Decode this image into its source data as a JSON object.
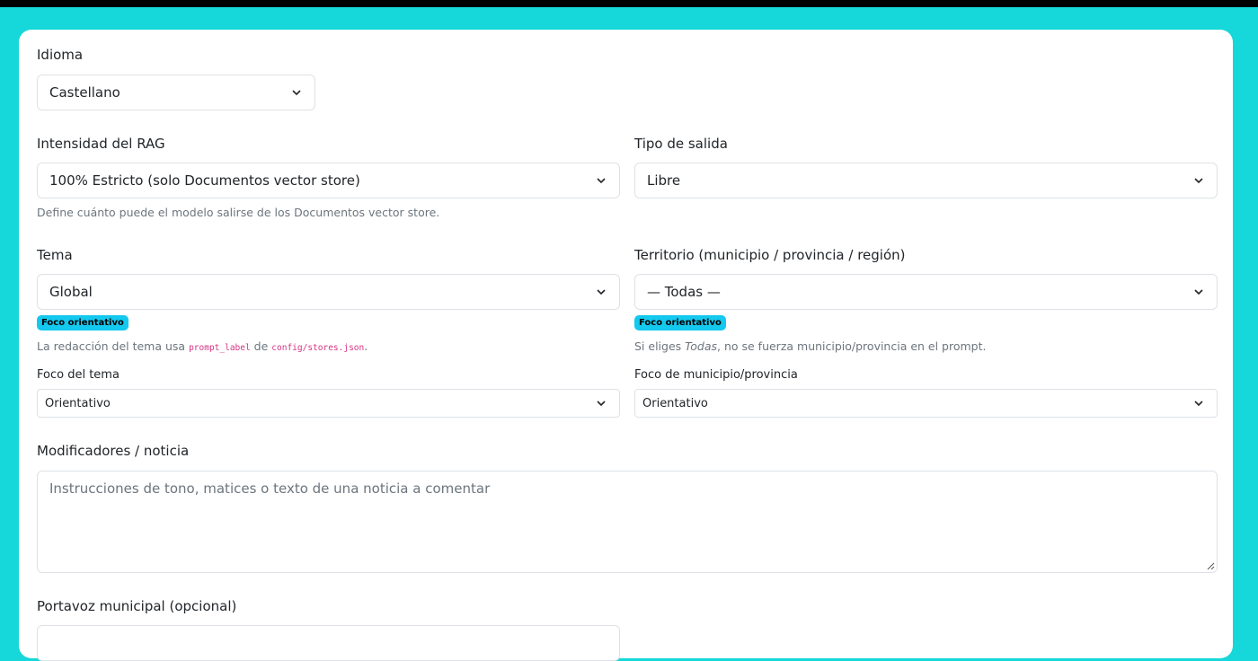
{
  "form": {
    "idioma": {
      "label": "Idioma",
      "value": "Castellano"
    },
    "rag": {
      "label": "Intensidad del RAG",
      "value": "100% Estricto (solo Documentos vector store)",
      "help": "Define cuánto puede el modelo salirse de los Documentos vector store."
    },
    "salida": {
      "label": "Tipo de salida",
      "value": "Libre"
    },
    "tema": {
      "label": "Tema",
      "value": "Global",
      "badge": "Foco orientativo",
      "help_prefix": "La redacción del tema usa ",
      "help_code1": "prompt_label",
      "help_mid": " de ",
      "help_code2": "config/stores.json",
      "help_suffix": "."
    },
    "territorio": {
      "label": "Territorio (municipio / provincia / región)",
      "value": "— Todas —",
      "badge": "Foco orientativo",
      "help_prefix": "Si eliges ",
      "help_em": "Todas",
      "help_suffix": ", no se fuerza municipio/provincia en el prompt."
    },
    "foco_tema": {
      "label": "Foco del tema",
      "value": "Orientativo"
    },
    "foco_municipio": {
      "label": "Foco de municipio/provincia",
      "value": "Orientativo"
    },
    "modificadores": {
      "label": "Modificadores / noticia",
      "placeholder": "Instrucciones de tono, matices o texto de una noticia a comentar"
    },
    "portavoz": {
      "label": "Portavoz municipal (opcional)"
    }
  },
  "icons": {
    "select_arrow": "chevron-down-icon",
    "resize": "resize-grip-icon"
  },
  "colors": {
    "background": "#16d7d9",
    "badge": "#14c8ee",
    "code": "#d63384"
  }
}
